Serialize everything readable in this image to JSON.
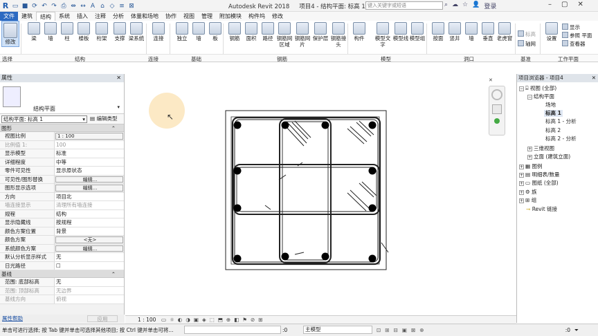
{
  "titlebar": {
    "app": "Autodesk Revit 2018",
    "project": "项目4 - 结构平面: 标高 1",
    "search_placeholder": "键入关键字或短语",
    "login": "登录"
  },
  "tabs": [
    "文件",
    "建筑",
    "结构",
    "系统",
    "插入",
    "注释",
    "分析",
    "体量和场地",
    "协作",
    "视图",
    "管理",
    "附加模块",
    "构件坞",
    "修改"
  ],
  "ribbon": {
    "select_label": "选择",
    "modify": "修改",
    "struct_buttons": [
      "梁",
      "墙",
      "柱",
      "楼板",
      "桁架",
      "支撑",
      "梁系统"
    ],
    "connect_buttons": [
      "连接"
    ],
    "found_buttons": [
      "独立",
      "墙",
      "板"
    ],
    "rebar_buttons": [
      "钢筋",
      "面积",
      "路径",
      "钢筋网区域",
      "钢筋网片",
      "保护层",
      "钢筋接头"
    ],
    "model_buttons": [
      "构件",
      "模型文字",
      "模型线",
      "模型组"
    ],
    "open_buttons": [
      "按面",
      "竖井",
      "墙",
      "垂直",
      "老虎窗"
    ],
    "datum_small": [
      "标高",
      "轴网"
    ],
    "workplane": [
      "设置",
      "显示",
      "参照 平面",
      "查看器"
    ],
    "panels": [
      "选择",
      "结构",
      "连接",
      "基础",
      "钢筋",
      "模型",
      "洞口",
      "基准",
      "工作平面"
    ]
  },
  "properties": {
    "title": "属性",
    "type_name": "结构平面",
    "instance": "结构平面: 标高 1",
    "edit_type": "编辑类型",
    "sections": [
      {
        "name": "图形",
        "rows": [
          {
            "k": "视图比例",
            "v": "1 : 100",
            "box": true
          },
          {
            "k": "比例值 1:",
            "v": "100",
            "dim": true
          },
          {
            "k": "显示模型",
            "v": "标准"
          },
          {
            "k": "详细程度",
            "v": "中等"
          },
          {
            "k": "零件可见性",
            "v": "显示原状态"
          },
          {
            "k": "可见性/图形替换",
            "v": "编辑...",
            "btn": true
          },
          {
            "k": "图形显示选项",
            "v": "编辑...",
            "btn": true
          },
          {
            "k": "方向",
            "v": "项目北"
          },
          {
            "k": "墙连接显示",
            "v": "清理所有墙连接",
            "dim": true
          },
          {
            "k": "规程",
            "v": "结构"
          },
          {
            "k": "显示隐藏线",
            "v": "按规程"
          },
          {
            "k": "颜色方案位置",
            "v": "背景"
          },
          {
            "k": "颜色方案",
            "v": "<无>",
            "btn": true
          },
          {
            "k": "系统颜色方案",
            "v": "编辑...",
            "btn": true
          },
          {
            "k": "默认分析显示样式",
            "v": "无"
          },
          {
            "k": "日光路径",
            "v": "☐"
          }
        ]
      },
      {
        "name": "基线",
        "rows": [
          {
            "k": "范围: 底部标高",
            "v": "无"
          },
          {
            "k": "范围: 顶部标高",
            "v": "无边界",
            "dim": true
          },
          {
            "k": "基线方向",
            "v": "俯视",
            "dim": true
          }
        ]
      }
    ],
    "help": "属性帮助",
    "apply": "应用"
  },
  "browser": {
    "title": "项目浏览器 - 项目4",
    "nodes": [
      "视图 (全部)",
      "结构平面",
      "场地",
      "标高 1",
      "标高 1 - 分析",
      "标高 2",
      "标高 2 - 分析",
      "三维视图",
      "立面 (建筑立面)",
      "图例",
      "明细表/数量",
      "图纸 (全部)",
      "族",
      "组",
      "Revit 链接"
    ]
  },
  "viewbar": {
    "scale": "1 : 100"
  },
  "status": {
    "hint": "单击可进行选择; 按 Tab 键并单击可选择其他项目; 按 Ctrl 键并单击可将...",
    "coord": ":0",
    "model": "主模型",
    "filter": ":0"
  }
}
